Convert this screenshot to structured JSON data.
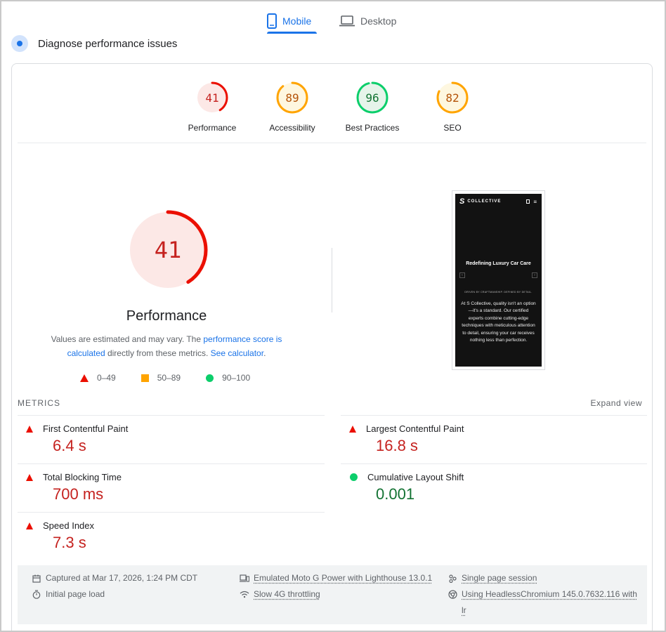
{
  "tabs": {
    "mobile_label": "Mobile",
    "desktop_label": "Desktop"
  },
  "header": {
    "title": "Diagnose performance issues"
  },
  "scores": [
    {
      "label": "Performance",
      "value": "41",
      "fraction": 0.41,
      "rating": "poor"
    },
    {
      "label": "Accessibility",
      "value": "89",
      "fraction": 0.89,
      "rating": "average"
    },
    {
      "label": "Best Practices",
      "value": "96",
      "fraction": 0.96,
      "rating": "good"
    },
    {
      "label": "SEO",
      "value": "82",
      "fraction": 0.82,
      "rating": "average"
    }
  ],
  "colors": {
    "poor": "#eb0f00",
    "poor_text": "#c5221f",
    "poor_bg": "#fce8e6",
    "average": "#ffa400",
    "average_text": "#b45309",
    "average_bg": "#fef7e0",
    "good": "#0cce6b",
    "good_text": "#137333",
    "good_bg": "#e6f4ea",
    "accent": "#1a73e8"
  },
  "main_gauge": {
    "value": "41",
    "fraction": 0.41,
    "title": "Performance"
  },
  "description": {
    "prefix": "Values are estimated and may vary. The ",
    "link1": "performance score is calculated",
    "middle": " directly from these metrics. ",
    "link2": "See calculator",
    "suffix": "."
  },
  "legend": {
    "poor": "0–49",
    "average": "50–89",
    "good": "90–100"
  },
  "screenshot": {
    "brand": "COLLECTIVE",
    "brand_mark": "S",
    "hero": "Redefining Luxury Car Care",
    "tagline": "DRIVEN BY CRAFTMANSHIP. DEFINED BY DETAIL.",
    "body": "At S Collective, quality isn't an option—it's a standard. Our certified experts combine cutting-edge techniques with meticulous attention to detail, ensuring your car receives nothing less than perfection."
  },
  "metrics": {
    "heading": "METRICS",
    "expand": "Expand view",
    "fcp": {
      "name": "First Contentful Paint",
      "value": "6.4 s"
    },
    "lcp": {
      "name": "Largest Contentful Paint",
      "value": "16.8 s"
    },
    "tbt": {
      "name": "Total Blocking Time",
      "value": "700 ms"
    },
    "cls": {
      "name": "Cumulative Layout Shift",
      "value": "0.001"
    },
    "si": {
      "name": "Speed Index",
      "value": "7.3 s"
    }
  },
  "info": {
    "captured": "Captured at Mar 17, 2026, 1:24 PM CDT",
    "load": "Initial page load",
    "device": "Emulated Moto G Power with Lighthouse 13.0.1",
    "throttle": "Slow 4G throttling",
    "session": "Single page session",
    "browser": "Using HeadlessChromium 145.0.7632.116 with lr"
  }
}
